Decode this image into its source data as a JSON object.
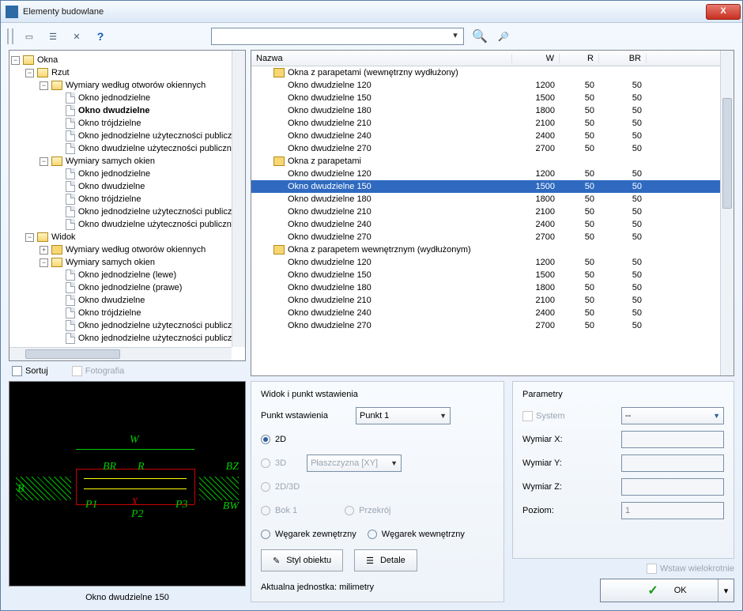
{
  "window": {
    "title": "Elementy budowlane",
    "close": "X"
  },
  "tree": {
    "root": "Okna",
    "n_rzut": "Rzut",
    "n_wwo": "Wymiary według otworów okiennych",
    "items_wwo": [
      "Okno jednodzielne",
      "Okno dwudzielne",
      "Okno trójdzielne",
      "Okno jednodzielne użyteczności publicznej",
      "Okno dwudzielne użyteczności publicznej"
    ],
    "n_wso": "Wymiary samych okien",
    "items_wso": [
      "Okno jednodzielne",
      "Okno dwudzielne",
      "Okno trójdzielne",
      "Okno jednodzielne użyteczności publicznej",
      "Okno dwudzielne użyteczności publicznej"
    ],
    "n_widok": "Widok",
    "n_wwo2": "Wymiary według otworów okiennych",
    "n_wso2": "Wymiary samych okien",
    "items_wso2": [
      "Okno jednodzielne (lewe)",
      "Okno jednodzielne (prawe)",
      "Okno dwudzielne",
      "Okno trójdzielne",
      "Okno jednodzielne użyteczności publicznej",
      "Okno jednodzielne użyteczności publicznej"
    ]
  },
  "sort": {
    "label": "Sortuj",
    "photo": "Fotografia"
  },
  "preview_label": "Okno dwudzielne 150",
  "list": {
    "headers": {
      "name": "Nazwa",
      "w": "W",
      "r": "R",
      "br": "BR"
    },
    "groups": [
      {
        "title": "Okna z parapetami (wewnętrzny wydłużony)",
        "rows": [
          {
            "n": "Okno dwudzielne 120",
            "w": "1200",
            "r": "50",
            "br": "50"
          },
          {
            "n": "Okno dwudzielne 150",
            "w": "1500",
            "r": "50",
            "br": "50"
          },
          {
            "n": "Okno dwudzielne 180",
            "w": "1800",
            "r": "50",
            "br": "50"
          },
          {
            "n": "Okno dwudzielne 210",
            "w": "2100",
            "r": "50",
            "br": "50"
          },
          {
            "n": "Okno dwudzielne 240",
            "w": "2400",
            "r": "50",
            "br": "50"
          },
          {
            "n": "Okno dwudzielne 270",
            "w": "2700",
            "r": "50",
            "br": "50"
          }
        ]
      },
      {
        "title": "Okna z parapetami",
        "rows": [
          {
            "n": "Okno dwudzielne 120",
            "w": "1200",
            "r": "50",
            "br": "50"
          },
          {
            "n": "Okno dwudzielne 150",
            "w": "1500",
            "r": "50",
            "br": "50",
            "selected": true
          },
          {
            "n": "Okno dwudzielne 180",
            "w": "1800",
            "r": "50",
            "br": "50"
          },
          {
            "n": "Okno dwudzielne 210",
            "w": "2100",
            "r": "50",
            "br": "50"
          },
          {
            "n": "Okno dwudzielne 240",
            "w": "2400",
            "r": "50",
            "br": "50"
          },
          {
            "n": "Okno dwudzielne 270",
            "w": "2700",
            "r": "50",
            "br": "50"
          }
        ]
      },
      {
        "title": "Okna z parapetem wewnętrznym (wydłużonym)",
        "rows": [
          {
            "n": "Okno dwudzielne 120",
            "w": "1200",
            "r": "50",
            "br": "50"
          },
          {
            "n": "Okno dwudzielne 150",
            "w": "1500",
            "r": "50",
            "br": "50"
          },
          {
            "n": "Okno dwudzielne 180",
            "w": "1800",
            "r": "50",
            "br": "50"
          },
          {
            "n": "Okno dwudzielne 210",
            "w": "2100",
            "r": "50",
            "br": "50"
          },
          {
            "n": "Okno dwudzielne 240",
            "w": "2400",
            "r": "50",
            "br": "50"
          },
          {
            "n": "Okno dwudzielne 270",
            "w": "2700",
            "r": "50",
            "br": "50"
          }
        ]
      }
    ]
  },
  "view_panel": {
    "title": "Widok i punkt wstawienia",
    "insert_label": "Punkt wstawienia",
    "insert_value": "Punkt 1",
    "r_2d": "2D",
    "r_3d": "3D",
    "r_2d3d": "2D/3D",
    "plane": "Płaszczyzna  [XY]",
    "r_side": "Bok 1",
    "r_section": "Przekrój",
    "r_ext": "Węgarek zewnętrzny",
    "r_int": "Węgarek wewnętrzny",
    "btn_style": "Styl obiektu",
    "btn_details": "Detale",
    "unit": "Aktualna jednostka: milimetry"
  },
  "param_panel": {
    "title": "Parametry",
    "system": "System",
    "system_value": "--",
    "x": "Wymiar X:",
    "y": "Wymiar Y:",
    "z": "Wymiar Z:",
    "level": "Poziom:",
    "level_value": "1"
  },
  "footer": {
    "multi": "Wstaw wielokrotnie",
    "ok": "OK"
  },
  "preview_labels": {
    "w": "W",
    "b": "B",
    "br": "BR",
    "r": "R",
    "bz": "BZ",
    "bw": "BW",
    "p1": "P1",
    "p2": "P2",
    "p3": "P3",
    "x": "X"
  }
}
